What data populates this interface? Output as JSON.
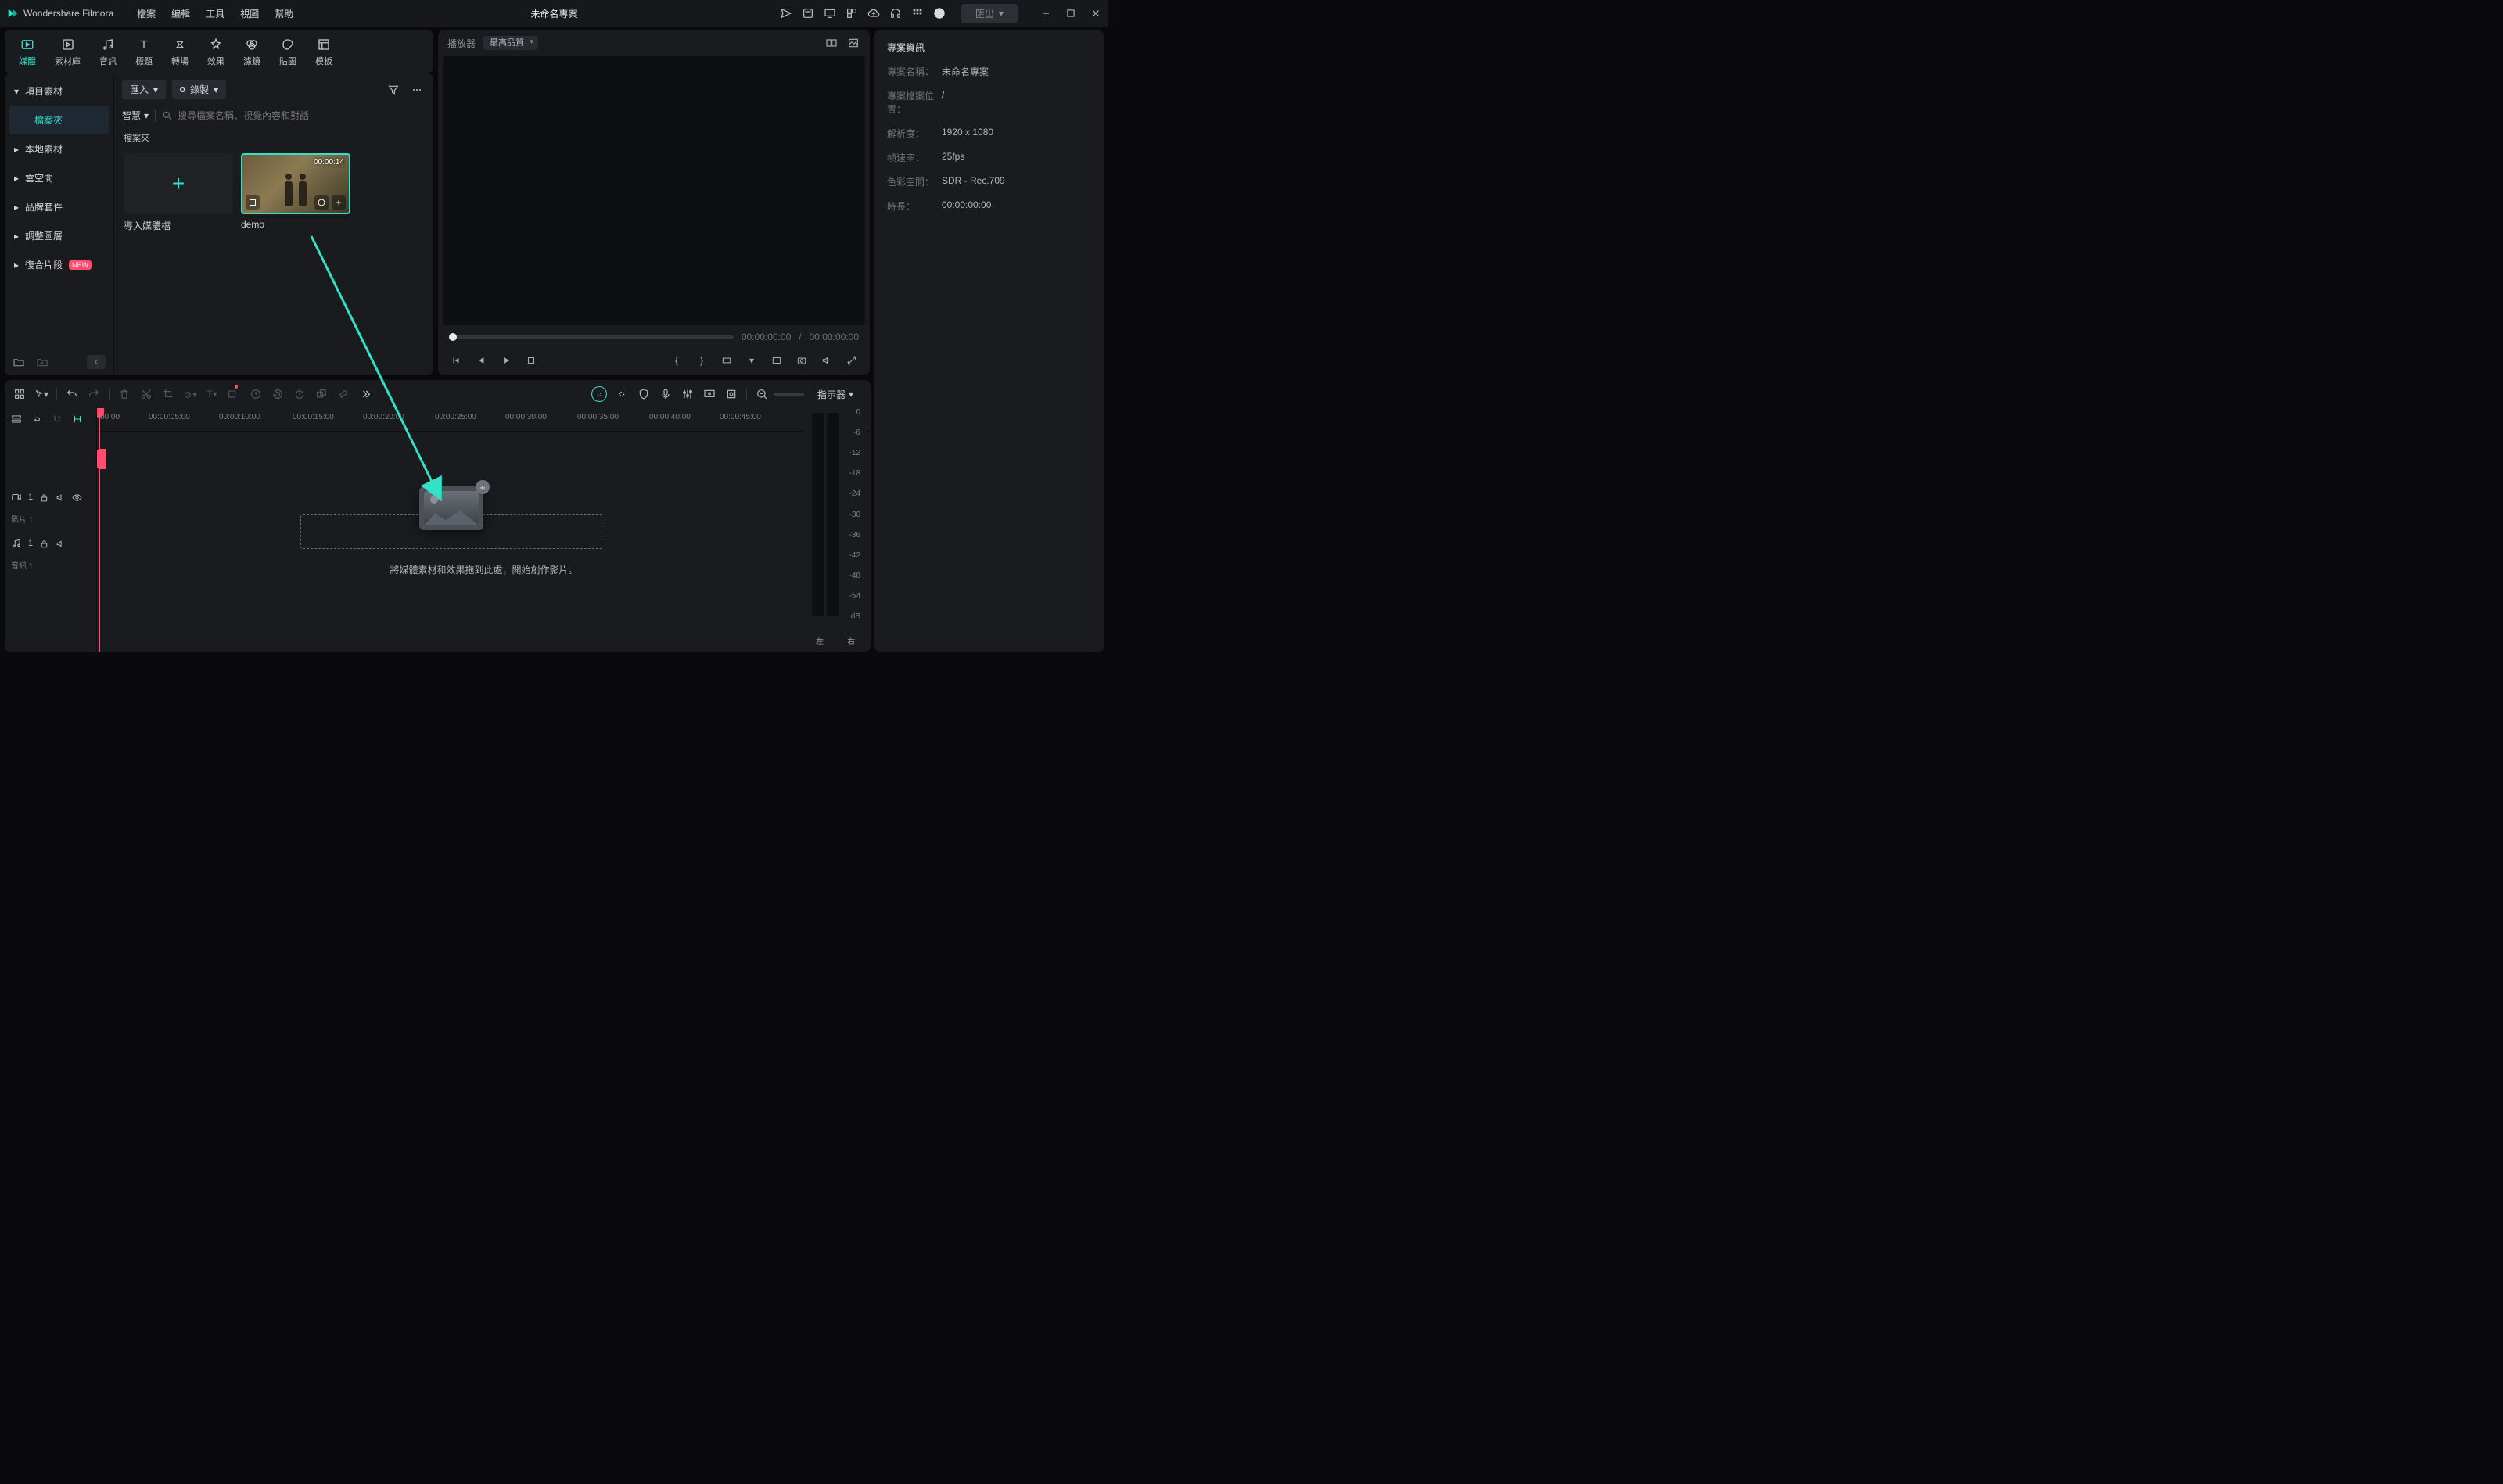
{
  "app_name": "Wondershare Filmora",
  "menus": [
    "檔案",
    "編輯",
    "工具",
    "視圖",
    "幫助"
  ],
  "doc_title": "未命名專案",
  "export_label": "匯出",
  "tool_tabs": [
    {
      "label": "媒體"
    },
    {
      "label": "素材庫"
    },
    {
      "label": "音訊"
    },
    {
      "label": "標題"
    },
    {
      "label": "轉場"
    },
    {
      "label": "效果"
    },
    {
      "label": "濾鏡"
    },
    {
      "label": "貼圖"
    },
    {
      "label": "模板"
    }
  ],
  "media_sidebar": {
    "items": [
      "項目素材",
      "本地素材",
      "雲空間",
      "品牌套件",
      "調整圖層",
      "復合片段"
    ],
    "sub": "檔案夾",
    "new_badge": "NEW"
  },
  "media_panel": {
    "import_label": "匯入",
    "record_label": "錄製",
    "smart_label": "智慧",
    "search_placeholder": "搜尋檔案名稱、視覺內容和對話",
    "section": "檔案夾",
    "thumbs": [
      {
        "label": "導入媒體檔"
      },
      {
        "label": "demo",
        "duration": "00:00:14"
      }
    ]
  },
  "player": {
    "tab": "播放器",
    "quality": "最高品質",
    "tc_cur": "00:00:00:00",
    "tc_total": "00:00:00:00"
  },
  "info": {
    "title": "專案資訊",
    "rows": [
      {
        "k": "專案名稱：",
        "v": "未命名專案"
      },
      {
        "k": "專案檔案位置：",
        "v": "/"
      },
      {
        "k": "解析度：",
        "v": "1920 x 1080"
      },
      {
        "k": "幀速率：",
        "v": "25fps"
      },
      {
        "k": "色彩空間：",
        "v": "SDR - Rec.709"
      },
      {
        "k": "時長：",
        "v": "00:00:00:00"
      }
    ]
  },
  "timeline": {
    "ruler": [
      "00:00",
      "00:00:05:00",
      "00:00:10:00",
      "00:00:15:00",
      "00:00:20:00",
      "00:00:25:00",
      "00:00:30:00",
      "00:00:35:00",
      "00:00:40:00",
      "00:00:45:00"
    ],
    "drop_hint": "將媒體素材和效果拖到此處，開始創作影片。",
    "video_track": {
      "num": "1",
      "label": "影片 1"
    },
    "audio_track": {
      "num": "1",
      "label": "音訊 1"
    }
  },
  "meter": {
    "title": "指示器",
    "levels": [
      "0",
      "-6",
      "-12",
      "-18",
      "-24",
      "-30",
      "-36",
      "-42",
      "-48",
      "-54",
      "dB"
    ],
    "left": "左",
    "right": "右"
  }
}
